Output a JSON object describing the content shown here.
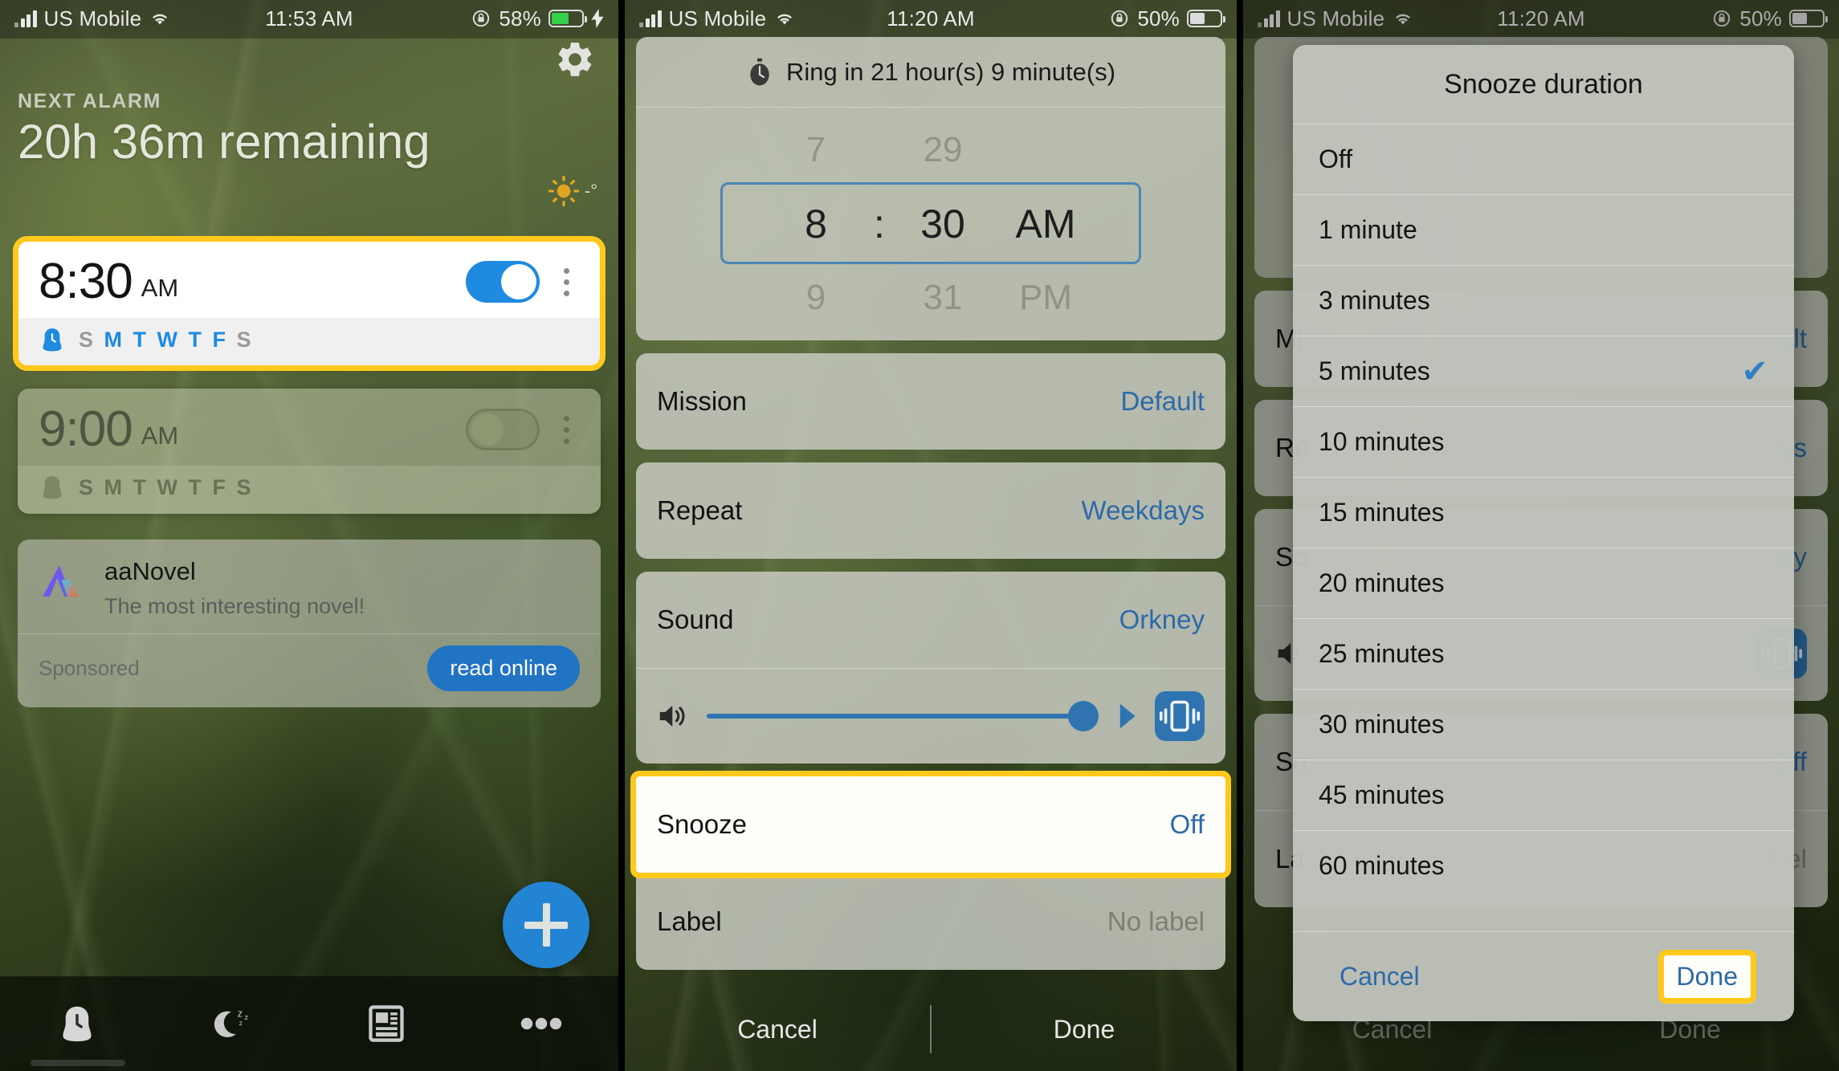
{
  "panel1": {
    "status": {
      "carrier": "US Mobile",
      "time": "11:53 AM",
      "battery": "58%",
      "battery_level": 58,
      "charging": true
    },
    "icons": {
      "gear": "gear-icon",
      "wifi": "wifi-icon",
      "signal": "signal-bars-icon",
      "rotation_lock": "rotation-lock-icon",
      "battery": "battery-icon",
      "bolt": "charging-bolt-icon"
    },
    "next_alarm_label": "NEXT ALARM",
    "next_alarm_value": "20h 36m remaining",
    "weather_degree": "-°",
    "alarms": [
      {
        "time": "8:30",
        "ampm": "AM",
        "enabled": true,
        "highlighted": true,
        "days": [
          {
            "letter": "S",
            "on": false
          },
          {
            "letter": "M",
            "on": true
          },
          {
            "letter": "T",
            "on": true
          },
          {
            "letter": "W",
            "on": true
          },
          {
            "letter": "T",
            "on": true
          },
          {
            "letter": "F",
            "on": true
          },
          {
            "letter": "S",
            "on": false
          }
        ]
      },
      {
        "time": "9:00",
        "ampm": "AM",
        "enabled": false,
        "highlighted": false,
        "days": [
          {
            "letter": "S",
            "on": false
          },
          {
            "letter": "M",
            "on": false
          },
          {
            "letter": "T",
            "on": false
          },
          {
            "letter": "W",
            "on": false
          },
          {
            "letter": "T",
            "on": false
          },
          {
            "letter": "F",
            "on": false
          },
          {
            "letter": "S",
            "on": false
          }
        ]
      }
    ],
    "ad": {
      "title": "aaNovel",
      "subtitle": "The most interesting novel!",
      "sponsored_label": "Sponsored",
      "cta_label": "read online"
    },
    "fab_label": "+",
    "nav": [
      {
        "name": "alarm",
        "icon": "alarm-clock-icon",
        "selected": true
      },
      {
        "name": "sleep",
        "icon": "moon-zzz-icon",
        "selected": false
      },
      {
        "name": "news",
        "icon": "news-card-icon",
        "selected": false
      },
      {
        "name": "more",
        "icon": "more-dots-icon",
        "selected": false
      }
    ]
  },
  "panel2": {
    "status": {
      "carrier": "US Mobile",
      "time": "11:20 AM",
      "battery": "50%",
      "battery_level": 50,
      "charging": false
    },
    "ring_text": "Ring in 21 hour(s) 9 minute(s)",
    "ring_icon": "stopwatch-icon",
    "picker": {
      "hour_prev": "7",
      "hour_cur": "8",
      "hour_next": "9",
      "minute_prev": "29",
      "minute_cur": "30",
      "minute_next": "31",
      "ampm_prev": "",
      "ampm_cur": "AM",
      "ampm_next": "PM",
      "separator": ":"
    },
    "rows": [
      {
        "label": "Mission",
        "value": "Default",
        "muted": false,
        "highlighted": false
      },
      {
        "label": "Repeat",
        "value": "Weekdays",
        "muted": false,
        "highlighted": false
      },
      {
        "label": "Sound",
        "value": "Orkney",
        "muted": false,
        "highlighted": false
      },
      {
        "label": "Snooze",
        "value": "Off",
        "muted": false,
        "highlighted": true
      },
      {
        "label": "Label",
        "value": "No label",
        "muted": true,
        "highlighted": false
      }
    ],
    "volume": {
      "percent": 92,
      "speaker_icon": "speaker-icon",
      "play_icon": "play-icon",
      "vibrate_icon": "vibrate-icon"
    },
    "actions": {
      "cancel": "Cancel",
      "done": "Done"
    }
  },
  "panel3": {
    "status": {
      "carrier": "US Mobile",
      "time": "11:20 AM",
      "battery": "50%",
      "battery_level": 50,
      "charging": false
    },
    "dialog": {
      "title": "Snooze duration",
      "options": [
        {
          "label": "Off",
          "checked": false
        },
        {
          "label": "1 minute",
          "checked": false
        },
        {
          "label": "3 minutes",
          "checked": false
        },
        {
          "label": "5 minutes",
          "checked": true
        },
        {
          "label": "10 minutes",
          "checked": false
        },
        {
          "label": "15 minutes",
          "checked": false
        },
        {
          "label": "20 minutes",
          "checked": false
        },
        {
          "label": "25 minutes",
          "checked": false
        },
        {
          "label": "30 minutes",
          "checked": false
        },
        {
          "label": "45 minutes",
          "checked": false
        },
        {
          "label": "60 minutes",
          "checked": false
        }
      ],
      "cancel_label": "Cancel",
      "done_label": "Done",
      "done_highlighted": true
    },
    "background_rows": [
      {
        "label": "Mi",
        "value": "ult"
      },
      {
        "label": "Re",
        "value": "ys"
      },
      {
        "label": "So",
        "value": "ey"
      },
      {
        "label": "Sn",
        "value": "Off"
      },
      {
        "label": "La",
        "value": "bel"
      }
    ],
    "actions": {
      "cancel": "Cancel",
      "done": "Done"
    }
  },
  "colors": {
    "highlight": "#ffc91c",
    "accent_blue": "#1e8ae0",
    "link_blue": "#2d6aa8",
    "battery_green": "#36cf4a"
  }
}
